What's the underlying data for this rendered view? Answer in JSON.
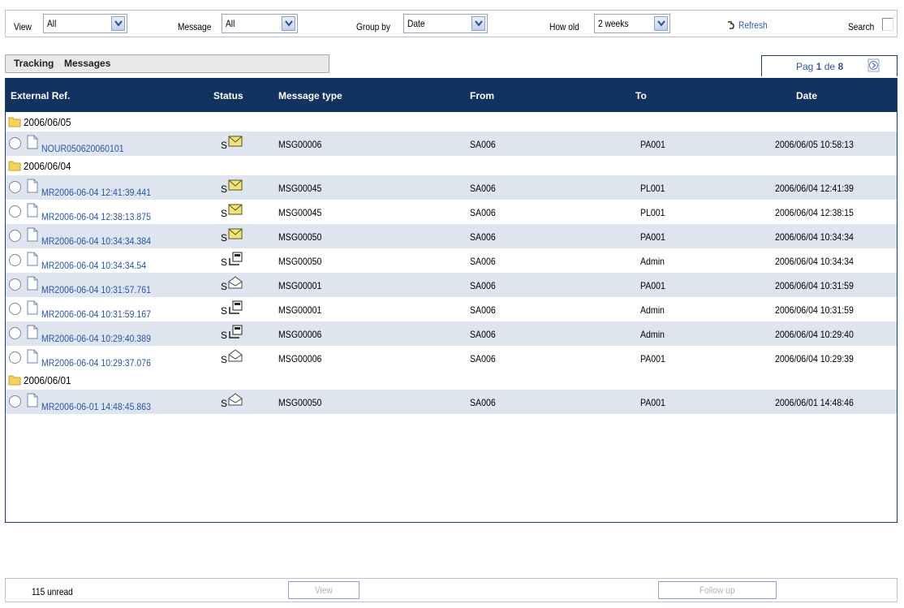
{
  "filters": {
    "view_label": "View",
    "view_value": "All",
    "message_label": "Message",
    "message_value": "All",
    "groupby_label": "Group by",
    "groupby_value": "Date",
    "howold_label": "How old",
    "howold_value": "2 weeks",
    "refresh_label": "Refresh",
    "search_label": "Search"
  },
  "tabs": [
    "Tracking",
    "Messages"
  ],
  "pager": {
    "prefix": "Pag",
    "current": "1",
    "sep": "de",
    "total": "8"
  },
  "columns": [
    "External Ref.",
    "Status",
    "Message type",
    "From",
    "To",
    "Date"
  ],
  "groups": [
    {
      "date": "2006/06/05",
      "rows": [
        {
          "ref": "NOUR050620060101",
          "status": "S",
          "icon": "mail-envelope-icon",
          "type": "MSG00006",
          "from": "SA006",
          "to": "PA001",
          "date": "2006/06/05 10:58:13"
        }
      ]
    },
    {
      "date": "2006/06/04",
      "rows": [
        {
          "ref": "MR2006-06-04 12:41:39.441",
          "status": "S",
          "icon": "mail-envelope-icon",
          "type": "MSG00045",
          "from": "SA006",
          "to": "PL001",
          "date": "2006/06/04 12:41:39"
        },
        {
          "ref": "MR2006-06-04 12:38:13.875",
          "status": "S",
          "icon": "mail-envelope-icon",
          "type": "MSG00045",
          "from": "SA006",
          "to": "PL001",
          "date": "2006/06/04 12:38:15"
        },
        {
          "ref": "MR2006-06-04 10:34:34.384",
          "status": "S",
          "icon": "mail-envelope-icon",
          "type": "MSG00050",
          "from": "SA006",
          "to": "PA001",
          "date": "2006/06/04 10:34:34"
        },
        {
          "ref": "MR2006-06-04 10:34:34.54",
          "status": "S",
          "icon": "outbox-tray-icon",
          "type": "MSG00050",
          "from": "SA006",
          "to": "Admin",
          "date": "2006/06/04 10:34:34"
        },
        {
          "ref": "MR2006-06-04 10:31:57.761",
          "status": "S",
          "icon": "open-envelope-icon",
          "type": "MSG00001",
          "from": "SA006",
          "to": "PA001",
          "date": "2006/06/04 10:31:59"
        },
        {
          "ref": "MR2006-06-04 10:31:59.167",
          "status": "S",
          "icon": "outbox-tray-icon",
          "type": "MSG00001",
          "from": "SA006",
          "to": "Admin",
          "date": "2006/06/04 10:31:59"
        },
        {
          "ref": "MR2006-06-04 10:29:40.389",
          "status": "S",
          "icon": "outbox-tray-icon",
          "type": "MSG00006",
          "from": "SA006",
          "to": "Admin",
          "date": "2006/06/04 10:29:40"
        },
        {
          "ref": "MR2006-06-04 10:29:37.076",
          "status": "S",
          "icon": "open-envelope-icon",
          "type": "MSG00006",
          "from": "SA006",
          "to": "PA001",
          "date": "2006/06/04 10:29:39"
        }
      ]
    },
    {
      "date": "2006/06/01",
      "rows": [
        {
          "ref": "MR2006-06-01 14:48:45.863",
          "status": "S",
          "icon": "open-envelope-icon",
          "type": "MSG00050",
          "from": "SA006",
          "to": "PA001",
          "date": "2006/06/01 14:48:46"
        }
      ]
    }
  ],
  "footer": {
    "unread": "115 unread",
    "view_button": "View",
    "followup_button": "Follow up"
  },
  "colors": {
    "header_bg": "#12335f",
    "alt_row": "#dfe5ee",
    "link": "#2a55a5"
  }
}
